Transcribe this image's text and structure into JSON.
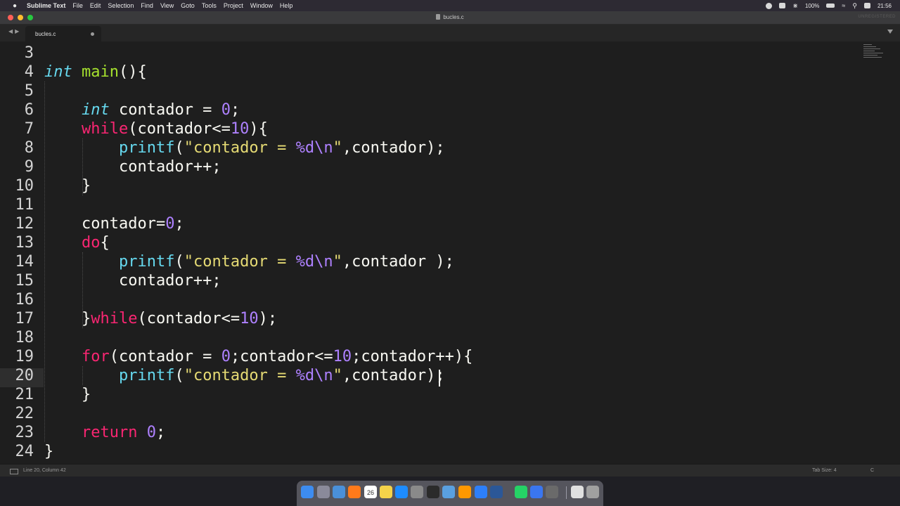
{
  "menubar": {
    "app_name": "Sublime Text",
    "menus": [
      "File",
      "Edit",
      "Selection",
      "Find",
      "View",
      "Goto",
      "Tools",
      "Project",
      "Window",
      "Help"
    ],
    "battery": "100%",
    "time": "21:56"
  },
  "window": {
    "title": "bucles.c",
    "unregistered": "UNREGISTERED"
  },
  "tabs": [
    {
      "label": "bucles.c",
      "modified": true
    }
  ],
  "editor": {
    "lines": [
      {
        "num": "3",
        "text": ""
      },
      {
        "num": "4",
        "text": "int main(){"
      },
      {
        "num": "5",
        "text": ""
      },
      {
        "num": "6",
        "text": "    int contador = 0;"
      },
      {
        "num": "7",
        "text": "    while(contador<=10){"
      },
      {
        "num": "8",
        "text": "        printf(\"contador = %d\\n\",contador);"
      },
      {
        "num": "9",
        "text": "        contador++;"
      },
      {
        "num": "10",
        "text": "    }"
      },
      {
        "num": "11",
        "text": ""
      },
      {
        "num": "12",
        "text": "    contador=0;"
      },
      {
        "num": "13",
        "text": "    do{"
      },
      {
        "num": "14",
        "text": "        printf(\"contador = %d\\n\",contador );"
      },
      {
        "num": "15",
        "text": "        contador++;"
      },
      {
        "num": "16",
        "text": ""
      },
      {
        "num": "17",
        "text": "    }while(contador<=10);"
      },
      {
        "num": "18",
        "text": ""
      },
      {
        "num": "19",
        "text": "    for(contador = 0;contador<=10;contador++){"
      },
      {
        "num": "20",
        "text": "        printf(\"contador = %d\\n\",contador);"
      },
      {
        "num": "21",
        "text": "    }"
      },
      {
        "num": "22",
        "text": ""
      },
      {
        "num": "23",
        "text": "    return 0;"
      },
      {
        "num": "24",
        "text": "}"
      }
    ],
    "current_line": "20"
  },
  "statusbar": {
    "position": "Line 20, Column 42",
    "tab_size": "Tab Size: 4",
    "syntax": "C"
  },
  "dock": {
    "icons": [
      "finder-icon",
      "launchpad-icon",
      "mail-icon",
      "firefox-icon",
      "calendar-icon",
      "notes-icon",
      "app-store-icon",
      "settings-icon",
      "terminal-icon",
      "virtualbox-icon",
      "sublime-text-icon",
      "xcode-icon",
      "word-icon",
      "whatsapp-icon",
      "signal-icon",
      "quicktime-icon",
      "document-icon",
      "trash-icon"
    ],
    "calendar_day": "26"
  },
  "colors": {
    "keyword": "#f92672",
    "type": "#66d9ef",
    "function_name": "#a6e22e",
    "number": "#ae81ff",
    "string": "#e6db74",
    "background": "#1e1e1e"
  }
}
